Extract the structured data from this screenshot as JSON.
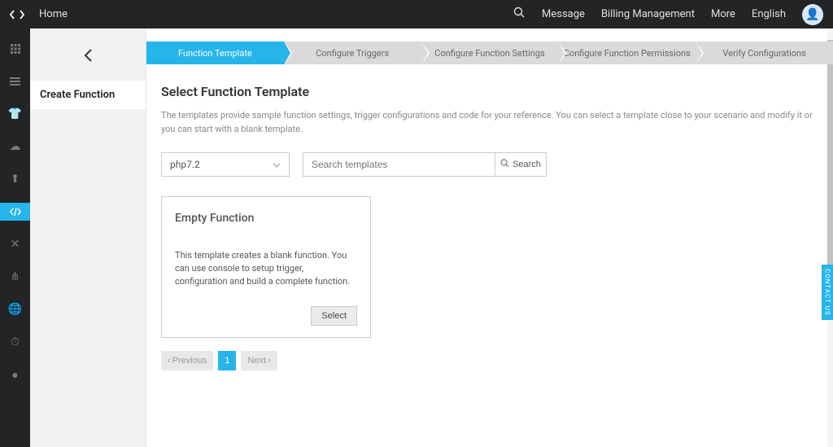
{
  "topbar": {
    "home": "Home",
    "links": {
      "message": "Message",
      "billing": "Billing Management",
      "more": "More",
      "language": "English"
    }
  },
  "leftPanel": {
    "createFunction": "Create Function"
  },
  "steps": {
    "s1": "Function Template",
    "s2": "Configure Triggers",
    "s3": "Configure Function Settings",
    "s4": "Configure Function Permissions",
    "s5": "Verify Configurations"
  },
  "page": {
    "title": "Select Function Template",
    "description": "The templates provide sample function settings, trigger configurations and code for your reference. You can select a template close to your scenario and modify it or you can start with a blank template."
  },
  "controls": {
    "runtime": "php7.2",
    "searchPlaceholder": "Search templates",
    "searchButton": "Search"
  },
  "templateCard": {
    "title": "Empty Function",
    "desc": "This template creates a blank function. You can use console to setup trigger, configuration and build a complete function.",
    "select": "Select"
  },
  "pagination": {
    "previous": "Previous",
    "page1": "1",
    "next": "Next"
  },
  "contactTab": "CONTACT US"
}
